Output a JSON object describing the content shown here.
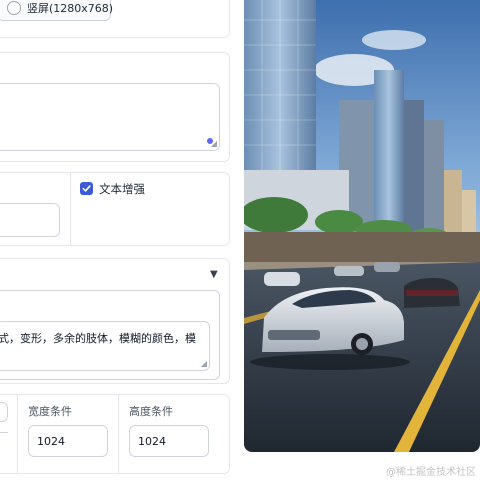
{
  "orientation": {
    "option_label": "竖屏(1280x768)",
    "selected": false
  },
  "prompt": {
    "value": "",
    "placeholder": ""
  },
  "options": {
    "left_value": "",
    "text_enhance_label": "文本增强",
    "text_enhance_checked": true
  },
  "negative": {
    "collapse_icon": "triangle-down-icon",
    "value": "式，变形，多余的肢体，模糊的颜色，模"
  },
  "conditions": {
    "width_label": "宽度条件",
    "width_value": "1024",
    "height_label": "高度条件",
    "height_value": "1024"
  },
  "image": {
    "alt_subject": "city-street-car-photo"
  },
  "watermark": "@稀土掘金技术社区",
  "colors": {
    "accent": "#3b5bdb",
    "border": "#e5e7eb"
  }
}
